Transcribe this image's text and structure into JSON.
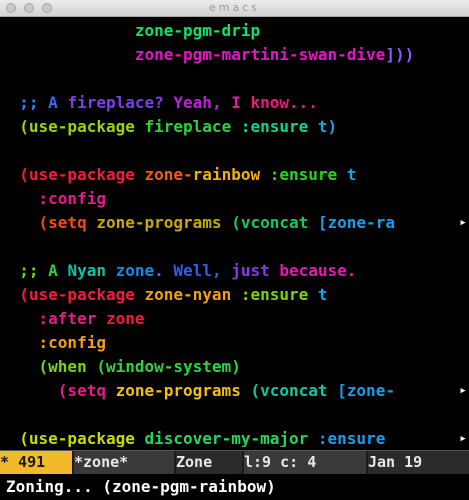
{
  "window": {
    "title": "emacs"
  },
  "buffer": {
    "lines": [
      [
        {
          "t": "              ",
          "c": "#000000"
        },
        {
          "t": "zone-pgm-drip",
          "c": "#11e06b"
        }
      ],
      [
        {
          "t": "              ",
          "c": "#000000"
        },
        {
          "t": "zone-pgm-martini-swan-dive",
          "c": "#e614c8"
        },
        {
          "t": "]))",
          "c": "#8b5cf6"
        }
      ],
      [
        {
          "t": "",
          "c": "#000000"
        }
      ],
      [
        {
          "t": "  ;; ",
          "c": "#1d8cf0"
        },
        {
          "t": "A ",
          "c": "#3b6af4"
        },
        {
          "t": "fireplace? ",
          "c": "#7c3fe8"
        },
        {
          "t": "Yeah, ",
          "c": "#c01fd8"
        },
        {
          "t": "I ",
          "c": "#e51aa9"
        },
        {
          "t": "know...",
          "c": "#f2177a"
        }
      ],
      [
        {
          "t": "  (use-package ",
          "c": "#9ad410"
        },
        {
          "t": "fireplace ",
          "c": "#2ed13a"
        },
        {
          "t": ":ensure ",
          "c": "#11d48a"
        },
        {
          "t": "t)",
          "c": "#12a6e4"
        }
      ],
      [
        {
          "t": "",
          "c": "#000000"
        }
      ],
      [
        {
          "t": "  (use-package ",
          "c": "#f21d3a"
        },
        {
          "t": "zone-",
          "c": "#f25d12"
        },
        {
          "t": "rainbow ",
          "c": "#f2b010"
        },
        {
          "t": ":ensure ",
          "c": "#2ad41e"
        },
        {
          "t": "t",
          "c": "#12a6e4"
        }
      ],
      [
        {
          "t": "    :config",
          "c": "#e51a8c"
        }
      ],
      [
        {
          "t": "    (setq ",
          "c": "#f24a12"
        },
        {
          "t": "zone-programs ",
          "c": "#c8a80a"
        },
        {
          "t": "(vconcat ",
          "c": "#18c85a"
        },
        {
          "t": "[zone-ra",
          "c": "#1b9ce8"
        }
      ],
      [
        {
          "t": "",
          "c": "#000000"
        }
      ],
      [
        {
          "t": "  ;; ",
          "c": "#74d80e"
        },
        {
          "t": "A ",
          "c": "#30d046"
        },
        {
          "t": "Nyan ",
          "c": "#12c0a8"
        },
        {
          "t": "zone. ",
          "c": "#128ce8"
        },
        {
          "t": "Well, ",
          "c": "#2f5ef0"
        },
        {
          "t": "just ",
          "c": "#8a3ae8"
        },
        {
          "t": "because.",
          "c": "#e11bb2"
        }
      ],
      [
        {
          "t": "  (use-package ",
          "c": "#f21d3a"
        },
        {
          "t": "zone-nyan ",
          "c": "#f2a010"
        },
        {
          "t": ":ensure ",
          "c": "#7cd40e"
        },
        {
          "t": "t",
          "c": "#12a6e4"
        }
      ],
      [
        {
          "t": "    :after ",
          "c": "#e51a8c"
        },
        {
          "t": "zone",
          "c": "#f21d3a"
        }
      ],
      [
        {
          "t": "    :config",
          "c": "#f2a010"
        }
      ],
      [
        {
          "t": "    (when ",
          "c": "#7cd40e"
        },
        {
          "t": "(window-system)",
          "c": "#2fd43a"
        }
      ],
      [
        {
          "t": "      (setq ",
          "c": "#e51a8c"
        },
        {
          "t": "zone-programs ",
          "c": "#f2c010"
        },
        {
          "t": "(vconcat ",
          "c": "#12c8a0"
        },
        {
          "t": "[zone-",
          "c": "#1b9ce8"
        }
      ],
      [
        {
          "t": "",
          "c": "#000000"
        }
      ],
      [
        {
          "t": "  (use-package ",
          "c": "#c8d80e"
        },
        {
          "t": "discover-my-major ",
          "c": "#2ad45a"
        },
        {
          "t": ":ensure",
          "c": "#1b9ce8"
        }
      ]
    ],
    "continuation_glyph": "▸",
    "continuation_rows": [
      8,
      15,
      17
    ]
  },
  "modeline": {
    "flag": "* 491",
    "buffer_name": "*zone*",
    "mode": "Zone",
    "position": "l:9 c: 4",
    "date": "Jan 19"
  },
  "echo": {
    "text": "Zoning... (zone-pgm-rainbow)"
  }
}
